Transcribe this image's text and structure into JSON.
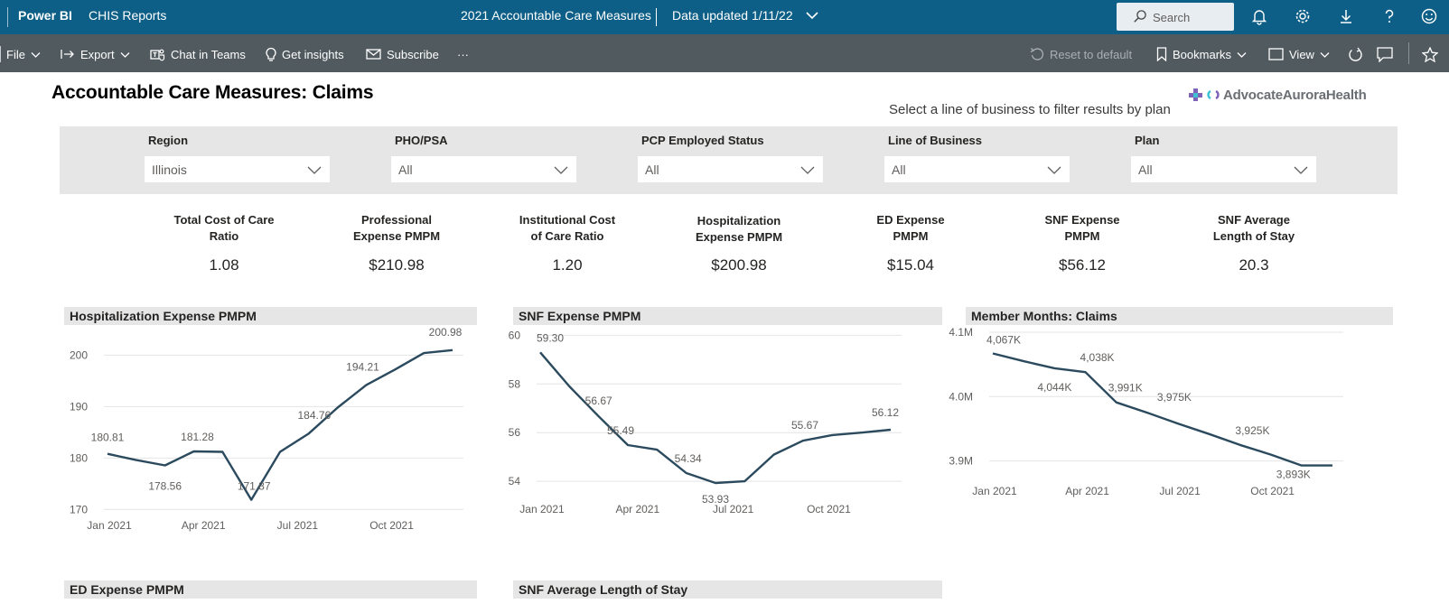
{
  "appbar": {
    "brand": "Power BI",
    "workspace": "CHIS Reports",
    "report_title": "2021 Accountable Care Measures",
    "data_updated": "Data updated 1/11/22",
    "search_placeholder": "Search",
    "bg_color": "#0e5f87"
  },
  "actionbar": {
    "file": "File",
    "export": "Export",
    "chat_in_teams": "Chat in Teams",
    "get_insights": "Get insights",
    "subscribe": "Subscribe",
    "more": "···",
    "reset_to_default": "Reset to default",
    "bookmarks": "Bookmarks",
    "view": "View"
  },
  "page": {
    "title": "Accountable Care Measures: Claims",
    "hint": "Select a line of business to filter results by plan",
    "logo_text": "AdvocateAuroraHealth"
  },
  "filters": [
    {
      "label": "Region",
      "value": "Illinois"
    },
    {
      "label": "PHO/PSA",
      "value": "All"
    },
    {
      "label": "PCP Employed Status",
      "value": "All"
    },
    {
      "label": "Line of Business",
      "value": "All"
    },
    {
      "label": "Plan",
      "value": "All"
    }
  ],
  "kpis": [
    {
      "line1": "Total Cost of Care",
      "line2": "Ratio",
      "value": "1.08"
    },
    {
      "line1": "Professional",
      "line2": "Expense PMPM",
      "value": "$210.98"
    },
    {
      "line1": "Institutional Cost",
      "line2": "of Care Ratio",
      "value": "1.20"
    },
    {
      "line1": "Hospitalization",
      "line2": "Expense PMPM",
      "value": "$200.98"
    },
    {
      "line1": "ED Expense",
      "line2": "PMPM",
      "value": "$15.04"
    },
    {
      "line1": "SNF Expense",
      "line2": "PMPM",
      "value": "$56.12"
    },
    {
      "line1": "SNF Average",
      "line2": "Length of Stay",
      "value": "20.3"
    }
  ],
  "bottom_headers": {
    "ed_expense": "ED Expense PMPM",
    "snf_los": "SNF Average Length of Stay"
  },
  "chart_data": [
    {
      "type": "line",
      "title": "Hospitalization Expense PMPM",
      "x": [
        "2021-01",
        "2021-02",
        "2021-03",
        "2021-04",
        "2021-05",
        "2021-06",
        "2021-07",
        "2021-08",
        "2021-09",
        "2021-10",
        "2021-11",
        "2021-12"
      ],
      "x_ticks": [
        "Jan 2021",
        "Apr 2021",
        "Jul 2021",
        "Oct 2021"
      ],
      "series": [
        {
          "values": [
            180.81,
            179.6,
            178.56,
            181.28,
            181.2,
            171.87,
            181.2,
            184.76,
            189.8,
            194.21,
            197.2,
            200.4,
            200.98
          ]
        }
      ],
      "labels": [
        "180.81",
        "178.56",
        "181.28",
        "171.87",
        "184.76",
        "194.21",
        "200.98"
      ],
      "yticks": [
        "170",
        "180",
        "190",
        "200"
      ],
      "ylim": [
        169,
        202
      ],
      "color": "#2b4a5e"
    },
    {
      "type": "line",
      "title": "SNF Expense PMPM",
      "x_ticks": [
        "Jan 2021",
        "Apr 2021",
        "Jul 2021",
        "Oct 2021"
      ],
      "series": [
        {
          "values": [
            59.3,
            57.9,
            56.67,
            55.49,
            55.3,
            54.34,
            53.93,
            54.0,
            55.1,
            55.67,
            55.9,
            56.0,
            56.12
          ]
        }
      ],
      "labels": [
        "59.30",
        "56.67",
        "55.49",
        "54.34",
        "53.93",
        "55.67",
        "56.12"
      ],
      "yticks": [
        "54",
        "56",
        "58",
        "60"
      ],
      "ylim": [
        53.3,
        60.2
      ],
      "color": "#2b4a5e"
    },
    {
      "type": "line",
      "title": "Member Months: Claims",
      "x_ticks": [
        "Jan 2021",
        "Apr 2021",
        "Jul 2021",
        "Oct 2021"
      ],
      "series": [
        {
          "values": [
            4067,
            4055,
            4044,
            4038,
            3991,
            3975,
            3958,
            3942,
            3925,
            3910,
            3893,
            3893
          ]
        }
      ],
      "labels": [
        "4,067K",
        "4,044K",
        "4,038K",
        "3,991K",
        "3,975K",
        "3,925K",
        "3,893K"
      ],
      "yticks": [
        "3.9M",
        "4.0M",
        "4.1M"
      ],
      "ylim": [
        3870,
        4100
      ],
      "color": "#2b4a5e"
    }
  ]
}
